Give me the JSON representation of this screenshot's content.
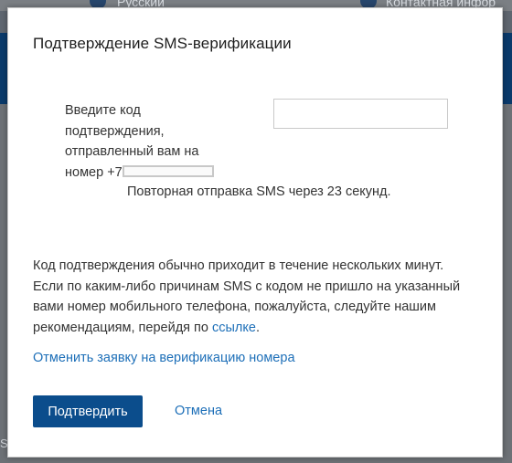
{
  "background": {
    "fragment_left": "Русский",
    "fragment_right": "Контактная инфор",
    "fragment_bottom": "S"
  },
  "dialog": {
    "title": "Подтверждение SMS-верификации",
    "prompt_text": "Введите код подтверждения, отправленный вам на номер +7",
    "code_input": {
      "value": "",
      "placeholder": ""
    },
    "resend_text": "Повторная отправка SMS через 23 секунд.",
    "info_text": "Код подтверждения обычно приходит в течение нескольких минут. Если по каким-либо причинам SMS с кодом не пришло на указанный вами номер мобильного телефона, пожалуйста, следуйте нашим рекомендациям, перейдя по ",
    "info_link": "ссылке",
    "info_end": ".",
    "cancel_request_link": "Отменить заявку на верификацию номера",
    "confirm_button": "Подтвердить",
    "cancel_button": "Отмена"
  },
  "colors": {
    "primary_button": "#0b4d8c",
    "link": "#1d6fb8",
    "header_band": "#0a3a6b"
  }
}
